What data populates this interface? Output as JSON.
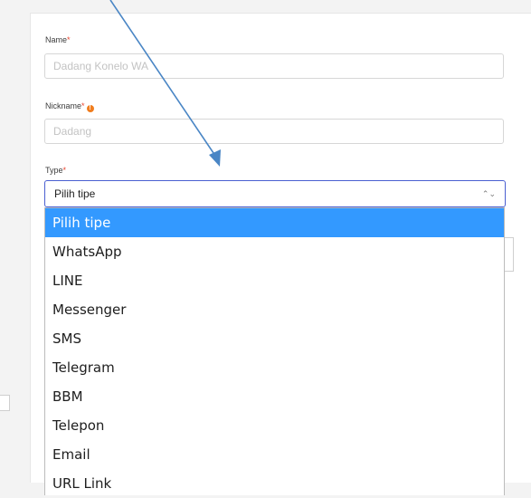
{
  "form": {
    "name": {
      "label": "Name",
      "required": "*",
      "value": "Dadang Konelo WA"
    },
    "nickname": {
      "label": "Nickname",
      "required": "*",
      "value": "Dadang"
    },
    "type": {
      "label": "Type",
      "required": "*",
      "selected": "Pilih tipe",
      "options": [
        "Pilih tipe",
        "WhatsApp",
        "LINE",
        "Messenger",
        "SMS",
        "Telegram",
        "BBM",
        "Telepon",
        "Email",
        "URL Link"
      ]
    }
  },
  "colors": {
    "required": "#e8442f",
    "info": "#f07d1e",
    "select_border": "#4a5fd1",
    "option_highlight": "#3399ff",
    "annotation_arrow": "#4a86c5"
  },
  "icons": {
    "info": "info-circle-icon",
    "select_arrows": "updown-chevrons-icon"
  }
}
